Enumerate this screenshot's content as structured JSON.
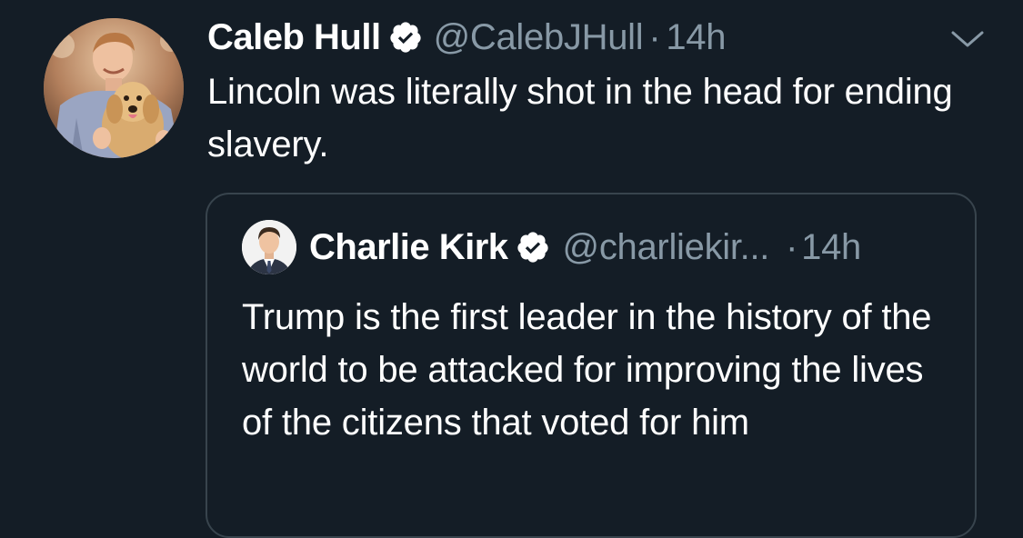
{
  "tweet": {
    "author": {
      "display_name": "Caleb Hull",
      "handle": "@CalebJHull",
      "verified": true,
      "avatar_icon": "profile-photo-man-with-puppy"
    },
    "separator": "·",
    "time": "14h",
    "text": "Lincoln was literally shot in the head for ending slavery.",
    "menu_icon": "chevron-down-icon"
  },
  "quoted_tweet": {
    "author": {
      "display_name": "Charlie Kirk",
      "handle": "@charliekir...",
      "verified": true,
      "avatar_icon": "profile-photo-man-in-suit"
    },
    "separator": "·",
    "time": "14h",
    "text": "Trump is the first leader in the history of the world to be attacked for improving the lives of the citizens that voted for him"
  },
  "colors": {
    "background": "#141d26",
    "text_primary": "#ffffff",
    "text_secondary": "#8899a6",
    "border": "#38444d",
    "verified_badge": "#ffffff"
  }
}
